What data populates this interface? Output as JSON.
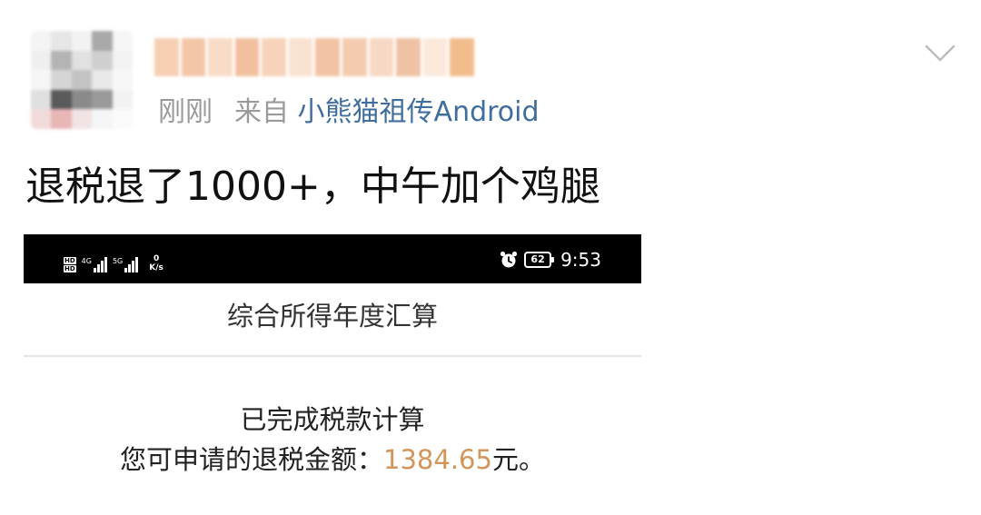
{
  "post": {
    "time": "刚刚",
    "via": "来自",
    "source": "小熊猫祖传Android",
    "text": "退税退了1000+，中午加个鸡腿"
  },
  "screenshot": {
    "status_bar": {
      "sim1": "HD",
      "sim2": "HD",
      "net1": "4G",
      "net2": "5G",
      "speed_value": "0",
      "speed_unit": "K/s",
      "battery": "62",
      "time": "9:53",
      "icons": [
        "signal-icon",
        "alarm-icon",
        "battery-icon"
      ]
    },
    "title": "综合所得年度汇算",
    "status_text": "已完成税款计算",
    "refund_prefix": "您可申请的退税金额：",
    "refund_amount": "1384.65",
    "refund_suffix": "元。"
  },
  "colors": {
    "source_link": "#3f6e9e",
    "meta_gray": "#9a9a9a",
    "amount": "#d4955a",
    "status_bar": "#000000"
  }
}
